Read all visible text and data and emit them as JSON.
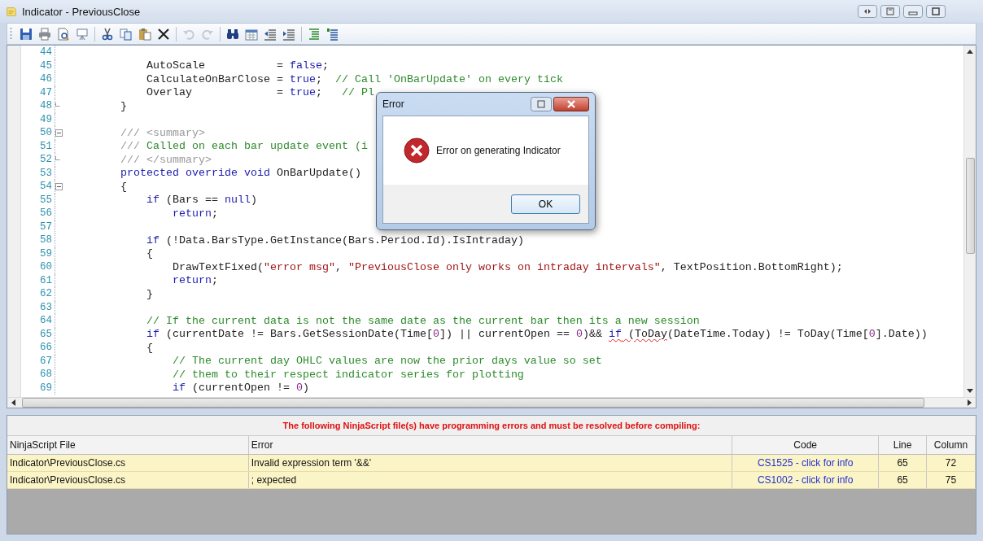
{
  "window": {
    "title": "Indicator - PreviousClose"
  },
  "toolbar_groups": [
    {
      "buttons": [
        {
          "kind": "save",
          "disabled": false
        },
        {
          "kind": "print",
          "disabled": false
        },
        {
          "kind": "preview",
          "disabled": false
        },
        {
          "kind": "easel",
          "disabled": false
        }
      ]
    },
    {
      "buttons": [
        {
          "kind": "cut",
          "disabled": false
        },
        {
          "kind": "copy",
          "disabled": false
        },
        {
          "kind": "paste",
          "disabled": false
        },
        {
          "kind": "delete",
          "disabled": false
        }
      ]
    },
    {
      "buttons": [
        {
          "kind": "undo",
          "disabled": true
        },
        {
          "kind": "redo",
          "disabled": true
        }
      ]
    },
    {
      "buttons": [
        {
          "kind": "find",
          "disabled": false
        },
        {
          "kind": "calendar",
          "disabled": false
        },
        {
          "kind": "outdent",
          "disabled": false
        },
        {
          "kind": "indent",
          "disabled": false
        }
      ]
    },
    {
      "buttons": [
        {
          "kind": "comment",
          "disabled": false
        },
        {
          "kind": "uncomment",
          "disabled": false
        }
      ]
    }
  ],
  "code_lines": [
    {
      "number": "44",
      "kind": "plain"
    },
    {
      "number": "45",
      "kind": "plain",
      "tokens": [
        {
          "t": "            AutoScale           = ",
          "kind": "plain"
        },
        {
          "t": "false",
          "kind": "keyword"
        },
        {
          "t": ";",
          "kind": "plain"
        }
      ]
    },
    {
      "number": "46",
      "kind": "plain",
      "tokens": [
        {
          "t": "            CalculateOnBarClose = ",
          "kind": "plain"
        },
        {
          "t": "true",
          "kind": "keyword"
        },
        {
          "t": ";  ",
          "kind": "plain"
        },
        {
          "t": "// Call 'OnBarUpdate' on every tick",
          "kind": "comment"
        }
      ]
    },
    {
      "number": "47",
      "kind": "plain",
      "tokens": [
        {
          "t": "            Overlay             = ",
          "kind": "plain"
        },
        {
          "t": "true",
          "kind": "keyword"
        },
        {
          "t": ";   ",
          "kind": "plain"
        },
        {
          "t": "// Pl",
          "kind": "comment"
        }
      ]
    },
    {
      "number": "48",
      "kind": "fold-end",
      "tokens": [
        {
          "t": "        }",
          "kind": "plain"
        }
      ]
    },
    {
      "number": "49",
      "kind": "plain"
    },
    {
      "number": "50",
      "kind": "fold-open",
      "tokens": [
        {
          "t": "        /// <summary>",
          "kind": "doc"
        }
      ]
    },
    {
      "number": "51",
      "kind": "plain",
      "tokens": [
        {
          "t": "        /// ",
          "kind": "doc"
        },
        {
          "t": "Called on each bar update event (i",
          "kind": "comment"
        }
      ]
    },
    {
      "number": "52",
      "kind": "fold-end",
      "tokens": [
        {
          "t": "        /// </summary>",
          "kind": "doc"
        }
      ]
    },
    {
      "number": "53",
      "kind": "plain",
      "tokens": [
        {
          "t": "        protected override void",
          "kind": "keyword"
        },
        {
          "t": " OnBarUpdate()",
          "kind": "plain"
        }
      ]
    },
    {
      "number": "54",
      "kind": "fold-open",
      "tokens": [
        {
          "t": "        {",
          "kind": "plain"
        }
      ]
    },
    {
      "number": "55",
      "kind": "plain",
      "tokens": [
        {
          "t": "            if",
          "kind": "keyword"
        },
        {
          "t": " (Bars == ",
          "kind": "plain"
        },
        {
          "t": "null",
          "kind": "keyword"
        },
        {
          "t": ")",
          "kind": "plain"
        }
      ]
    },
    {
      "number": "56",
      "kind": "plain",
      "tokens": [
        {
          "t": "                return",
          "kind": "keyword"
        },
        {
          "t": ";",
          "kind": "plain"
        }
      ]
    },
    {
      "number": "57",
      "kind": "plain"
    },
    {
      "number": "58",
      "kind": "plain",
      "tokens": [
        {
          "t": "            if",
          "kind": "keyword"
        },
        {
          "t": " (!Data.BarsType.GetInstance(Bars.Period.Id).IsIntraday)",
          "kind": "plain"
        }
      ]
    },
    {
      "number": "59",
      "kind": "plain",
      "tokens": [
        {
          "t": "            {",
          "kind": "plain"
        }
      ]
    },
    {
      "number": "60",
      "kind": "plain",
      "tokens": [
        {
          "t": "                DrawTextFixed(",
          "kind": "plain"
        },
        {
          "t": "\"error msg\"",
          "kind": "string"
        },
        {
          "t": ", ",
          "kind": "plain"
        },
        {
          "t": "\"PreviousClose only works on intraday intervals\"",
          "kind": "string"
        },
        {
          "t": ", TextPosition.BottomRight);",
          "kind": "plain"
        }
      ]
    },
    {
      "number": "61",
      "kind": "plain",
      "tokens": [
        {
          "t": "                return",
          "kind": "keyword"
        },
        {
          "t": ";",
          "kind": "plain"
        }
      ]
    },
    {
      "number": "62",
      "kind": "plain",
      "tokens": [
        {
          "t": "            }",
          "kind": "plain"
        }
      ]
    },
    {
      "number": "63",
      "kind": "plain"
    },
    {
      "number": "64",
      "kind": "plain",
      "tokens": [
        {
          "t": "            // If the current data is not the same date as the current bar then its a new session",
          "kind": "comment"
        }
      ]
    },
    {
      "number": "65",
      "kind": "plain",
      "tokens": [
        {
          "t": "            if",
          "kind": "keyword"
        },
        {
          "t": " (currentDate != Bars.GetSessionDate(Time[",
          "kind": "plain"
        },
        {
          "t": "0",
          "kind": "number"
        },
        {
          "t": "]) || currentOpen == ",
          "kind": "plain"
        },
        {
          "t": "0",
          "kind": "number"
        },
        {
          "t": ")&& ",
          "kind": "plain"
        },
        {
          "t": "if",
          "kind": "keyword",
          "squiggle": true
        },
        {
          "t": " (ToDay",
          "kind": "plain",
          "squiggle": true
        },
        {
          "t": "(DateTime.Today) != ToDay(Time[",
          "kind": "plain"
        },
        {
          "t": "0",
          "kind": "number"
        },
        {
          "t": "].Date))",
          "kind": "plain"
        }
      ]
    },
    {
      "number": "66",
      "kind": "plain",
      "tokens": [
        {
          "t": "            {",
          "kind": "plain"
        }
      ]
    },
    {
      "number": "67",
      "kind": "plain",
      "tokens": [
        {
          "t": "                // The current day OHLC values are now the prior days value so set",
          "kind": "comment"
        }
      ]
    },
    {
      "number": "68",
      "kind": "plain",
      "tokens": [
        {
          "t": "                // them to their respect indicator series for plotting",
          "kind": "comment"
        }
      ]
    },
    {
      "number": "69",
      "kind": "plain",
      "tokens": [
        {
          "t": "                if",
          "kind": "keyword"
        },
        {
          "t": " (currentOpen != ",
          "kind": "plain"
        },
        {
          "t": "0",
          "kind": "number"
        },
        {
          "t": ")",
          "kind": "plain"
        }
      ]
    }
  ],
  "dialog": {
    "title": "Error",
    "message": "Error on generating Indicator",
    "button": "OK"
  },
  "errors": {
    "heading": "The following NinjaScript file(s) have programming errors and must be resolved before compiling:",
    "columns": [
      "NinjaScript File",
      "Error",
      "Code",
      "Line",
      "Column"
    ],
    "rows": [
      {
        "file": "Indicator\\PreviousClose.cs",
        "error": "Invalid expression term '&&'",
        "code": "CS1525 - click for info",
        "line": "65",
        "column": "72"
      },
      {
        "file": "Indicator\\PreviousClose.cs",
        "error": "; expected",
        "code": "CS1002 - click for info",
        "line": "65",
        "column": "75"
      }
    ]
  }
}
